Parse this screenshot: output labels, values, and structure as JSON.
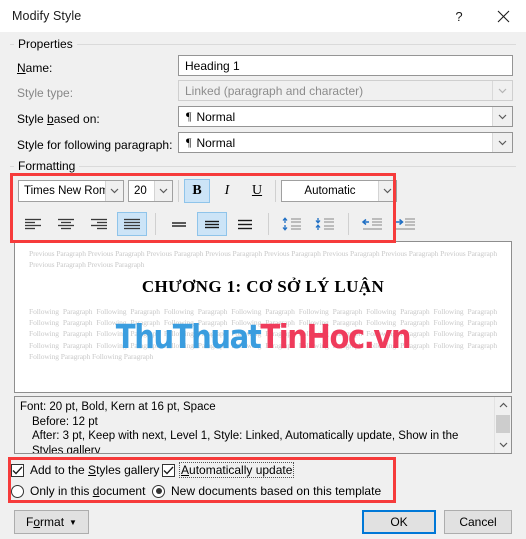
{
  "window": {
    "title": "Modify Style",
    "help_label": "?",
    "close_label": "✕",
    "help_icon": "question-mark-icon",
    "close_icon": "close-icon"
  },
  "properties": {
    "group_label": "Properties",
    "name_label": "Name:",
    "name_value": "Heading 1",
    "style_type_label": "Style type:",
    "style_type_value": "Linked (paragraph and character)",
    "style_based_on_label": "Style based on:",
    "style_based_on_value": "Normal",
    "style_following_label": "Style for following paragraph:",
    "style_following_value": "Normal",
    "pilcrow": "¶"
  },
  "formatting": {
    "group_label": "Formatting",
    "font_family": "Times New Roman",
    "font_size": "20",
    "bold_label": "B",
    "italic_label": "I",
    "underline_label": "U",
    "font_color": "Automatic",
    "bold_active": true,
    "align_active": "justify",
    "line_spacing_active": "1.5",
    "icons": [
      "align-left-icon",
      "align-center-icon",
      "align-right-icon",
      "align-justify-icon",
      "line-spacing-single-icon",
      "line-spacing-1-5-icon",
      "line-spacing-double-icon",
      "spacing-before-icon",
      "spacing-after-icon",
      "decrease-indent-icon",
      "increase-indent-icon"
    ]
  },
  "preview": {
    "previous_paragraph": "Previous Paragraph Previous Paragraph Previous Paragraph Previous Paragraph Previous Paragraph Previous Paragraph Previous Paragraph Previous Paragraph Previous Paragraph Previous Paragraph",
    "heading_text": "CHƯƠNG 1: CƠ SỞ LÝ LUẬN",
    "following_paragraph": "Following Paragraph Following Paragraph Following Paragraph Following Paragraph Following Paragraph Following Paragraph Following Paragraph Following Paragraph Following Paragraph Following Paragraph Following Paragraph Following Paragraph Following Paragraph Following Paragraph Following Paragraph Following Paragraph Following Paragraph Following Paragraph Following Paragraph Following Paragraph Following Paragraph Following Paragraph Following Paragraph Following Paragraph Following Paragraph Following Paragraph Following Paragraph Following Paragraph Following Paragraph Following Paragraph",
    "watermark_part1": "ThuThuat",
    "watermark_part2": "TinHoc.vn",
    "watermark_color1": "#3a9ddf",
    "watermark_color2": "#ef3b5b"
  },
  "description": {
    "line1": "Font: 20 pt, Bold, Kern at 16 pt, Space",
    "line2": "Before:  12 pt",
    "line3": "After:  3 pt, Keep with next, Level 1, Style: Linked, Automatically update, Show in the Styles gallery"
  },
  "options": {
    "add_gallery_label": "Add to the Styles gallery",
    "add_gallery_checked": true,
    "auto_update_label": "Automatically update",
    "auto_update_checked": true,
    "only_document_label": "Only in this document",
    "only_document_selected": false,
    "new_documents_label": "New documents based on this template",
    "new_documents_selected": true
  },
  "footer": {
    "format_label": "Format",
    "format_caret": "▼",
    "ok_label": "OK",
    "cancel_label": "Cancel"
  },
  "annotations": {
    "accent_color": "#f63b3b"
  }
}
